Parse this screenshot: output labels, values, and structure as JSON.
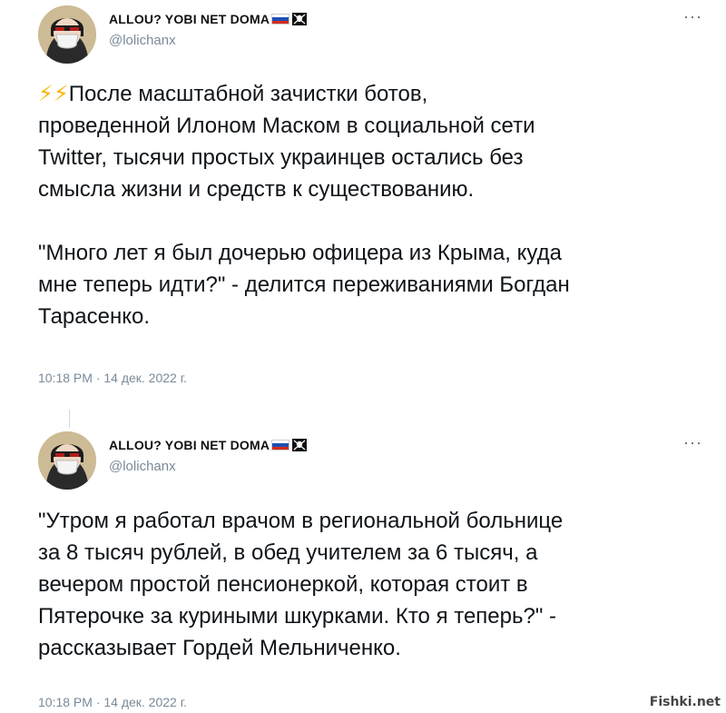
{
  "tweets": [
    {
      "display_name": "ALLOU? YOBI NET DOMA",
      "handle": "@lolichanx",
      "more_label": "···",
      "emoji_prefix": "⚡⚡",
      "text": "После масштабной зачистки ботов,\nпроведенной Илоном Маском в социальной сети\nTwitter, тысячи простых украинцев остались без\nсмысла жизни и средств к существованию.\n\n\"Много лет я был дочерью офицера из Крыма, куда\nмне теперь идти?\" - делится переживаниями Богдан\nТарасенко.",
      "timestamp": "10:18 PM · 14 дек. 2022 г."
    },
    {
      "display_name": "ALLOU? YOBI NET DOMA",
      "handle": "@lolichanx",
      "more_label": "···",
      "text": "\"Утром я работал врачом в региональной больнице\nза 8 тысяч рублей, в обед учителем за 6 тысяч, а\nвечером простой пенсионеркой, которая стоит в\nПятерочке за куриными шкурками. Кто я теперь?\" -\nрассказывает Гордей Мельниченко.",
      "timestamp": "10:18 PM · 14 дек. 2022 г."
    }
  ],
  "watermark": "Fishki.net",
  "colors": {
    "text": "#0f1419",
    "muted": "#7a8a99",
    "bolt": "#f7b500"
  }
}
